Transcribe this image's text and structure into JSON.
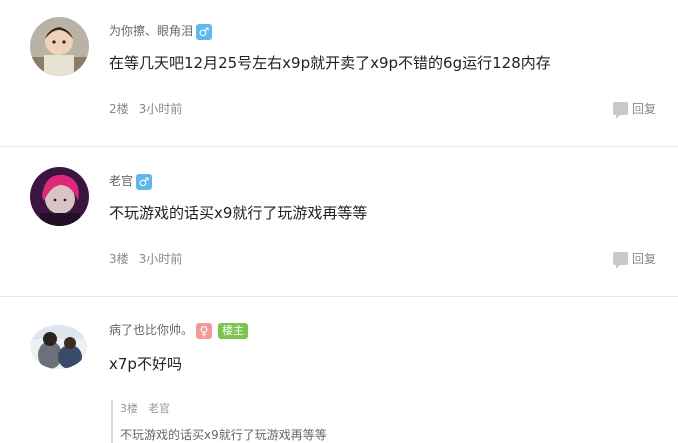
{
  "posts": [
    {
      "username": "为你擦、眼角泪",
      "gender_symbol": "♂",
      "content": "在等几天吧12月25号左右x9p就开卖了x9p不错的6g运行128内存",
      "floor": "2楼",
      "time": "3小时前",
      "reply_label": "回复"
    },
    {
      "username": "老官",
      "gender_symbol": "♂",
      "content": "不玩游戏的话买x9就行了玩游戏再等等",
      "floor": "3楼",
      "time": "3小时前",
      "reply_label": "回复"
    },
    {
      "username": "病了也比你帅。",
      "gender_symbol": "♀",
      "badge": "楼主",
      "content": "x7p不好吗",
      "quote": {
        "floor": "3楼",
        "user": "老官",
        "text": "不玩游戏的话买x9就行了玩游戏再等等"
      }
    }
  ],
  "colors": {
    "male": "#5fb8e8",
    "female": "#f29a9a",
    "owner_badge": "#7cc44d",
    "divider": "#e8e8e8"
  }
}
